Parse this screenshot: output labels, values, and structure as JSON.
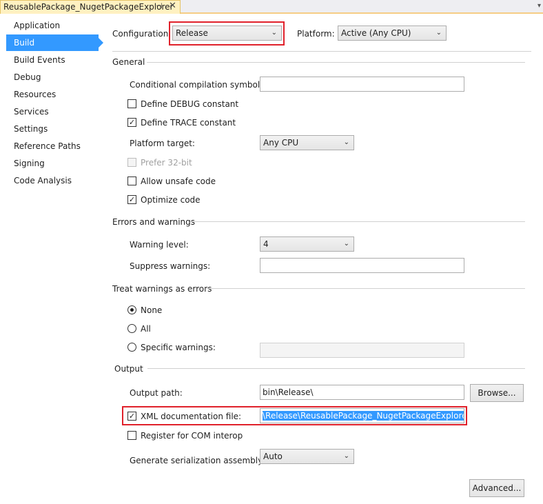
{
  "tab": {
    "title": "ReusablePackage_NugetPackageExplorer",
    "pin_icon": "pin-icon",
    "close_icon": "close-icon",
    "pin_glyph": "⊣",
    "close_glyph": "✕",
    "overflow_glyph": "▾"
  },
  "sidebar": {
    "items": [
      {
        "label": "Application"
      },
      {
        "label": "Build"
      },
      {
        "label": "Build Events"
      },
      {
        "label": "Debug"
      },
      {
        "label": "Resources"
      },
      {
        "label": "Services"
      },
      {
        "label": "Settings"
      },
      {
        "label": "Reference Paths"
      },
      {
        "label": "Signing"
      },
      {
        "label": "Code Analysis"
      }
    ],
    "active_index": 1
  },
  "config": {
    "configuration_label": "Configuration:",
    "configuration_value": "Release",
    "platform_label": "Platform:",
    "platform_value": "Active (Any CPU)"
  },
  "general": {
    "header": "General",
    "conditional_label": "Conditional compilation symbols:",
    "conditional_value": "",
    "define_debug_label": "Define DEBUG constant",
    "define_debug_checked": false,
    "define_trace_label": "Define TRACE constant",
    "define_trace_checked": true,
    "platform_target_label": "Platform target:",
    "platform_target_value": "Any CPU",
    "prefer32_label": "Prefer 32-bit",
    "prefer32_checked": false,
    "unsafe_label": "Allow unsafe code",
    "unsafe_checked": false,
    "optimize_label": "Optimize code",
    "optimize_checked": true
  },
  "errors": {
    "header": "Errors and warnings",
    "warning_level_label": "Warning level:",
    "warning_level_value": "4",
    "suppress_label": "Suppress warnings:",
    "suppress_value": ""
  },
  "treat": {
    "header": "Treat warnings as errors",
    "none_label": "None",
    "all_label": "All",
    "specific_label": "Specific warnings:",
    "selected": "None",
    "specific_value": ""
  },
  "output": {
    "header": "Output",
    "output_path_label": "Output path:",
    "output_path_value": "bin\\Release\\",
    "browse_label": "Browse...",
    "xml_doc_label": "XML documentation file:",
    "xml_doc_checked": true,
    "xml_doc_value": "\\Release\\ReusablePackage_NugetPackageExplorer.XML",
    "com_label": "Register for COM interop",
    "com_checked": false,
    "serialization_label": "Generate serialization assembly:",
    "serialization_value": "Auto",
    "advanced_label": "Advanced..."
  },
  "colors": {
    "accent": "#3399ff",
    "highlight": "#e0202a",
    "tab_background": "#fff1c1"
  },
  "glyphs": {
    "check": "✓",
    "chevron": "⌄"
  }
}
